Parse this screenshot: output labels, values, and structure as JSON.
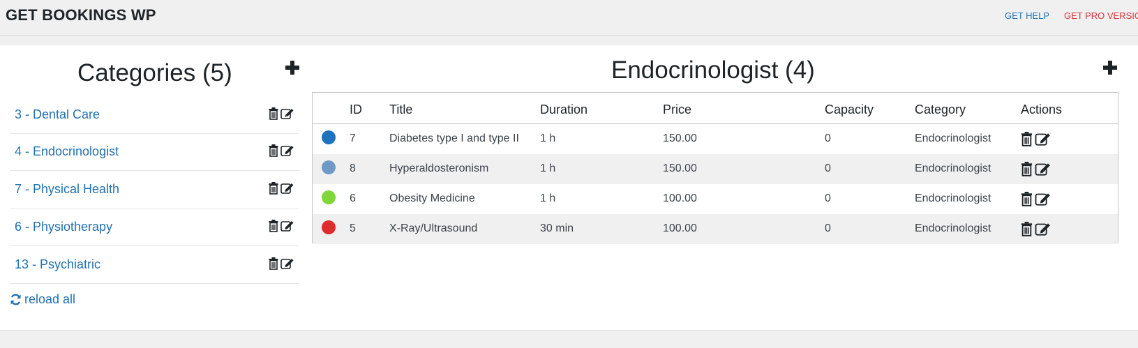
{
  "header": {
    "brand": "GET BOOKINGS WP",
    "help_link": "GET HELP",
    "pro_link": "GET PRO VERSIO"
  },
  "categories": {
    "title": "Categories (5)",
    "items": [
      {
        "label": "3 - Dental Care"
      },
      {
        "label": "4 - Endocrinologist"
      },
      {
        "label": "7 - Physical Health"
      },
      {
        "label": "6 - Physiotherapy"
      },
      {
        "label": "13 - Psychiatric"
      }
    ],
    "reload_label": "reload all"
  },
  "services": {
    "title": "Endocrinologist (4)",
    "columns": [
      "ID",
      "Title",
      "Duration",
      "Price",
      "Capacity",
      "Category",
      "Actions"
    ],
    "rows": [
      {
        "color": "#1e73be",
        "id": "7",
        "title": "Diabetes type I and type II",
        "duration": "1 h",
        "price": "150.00",
        "capacity": "0",
        "category": "Endocrinologist"
      },
      {
        "color": "#6f9ac5",
        "id": "8",
        "title": "Hyperaldosteronism",
        "duration": "1 h",
        "price": "150.00",
        "capacity": "0",
        "category": "Endocrinologist"
      },
      {
        "color": "#7ed63a",
        "id": "6",
        "title": "Obesity Medicine",
        "duration": "1 h",
        "price": "100.00",
        "capacity": "0",
        "category": "Endocrinologist"
      },
      {
        "color": "#dd2c2c",
        "id": "5",
        "title": "X-Ray/Ultrasound",
        "duration": "30 min",
        "price": "100.00",
        "capacity": "0",
        "category": "Endocrinologist"
      }
    ]
  },
  "icons": {
    "add": "plus-icon",
    "delete": "trash-icon",
    "edit": "edit-icon",
    "reload": "refresh-icon"
  },
  "colors": {
    "link": "#2271b1",
    "pro": "#d63638",
    "text": "#1d2327"
  }
}
